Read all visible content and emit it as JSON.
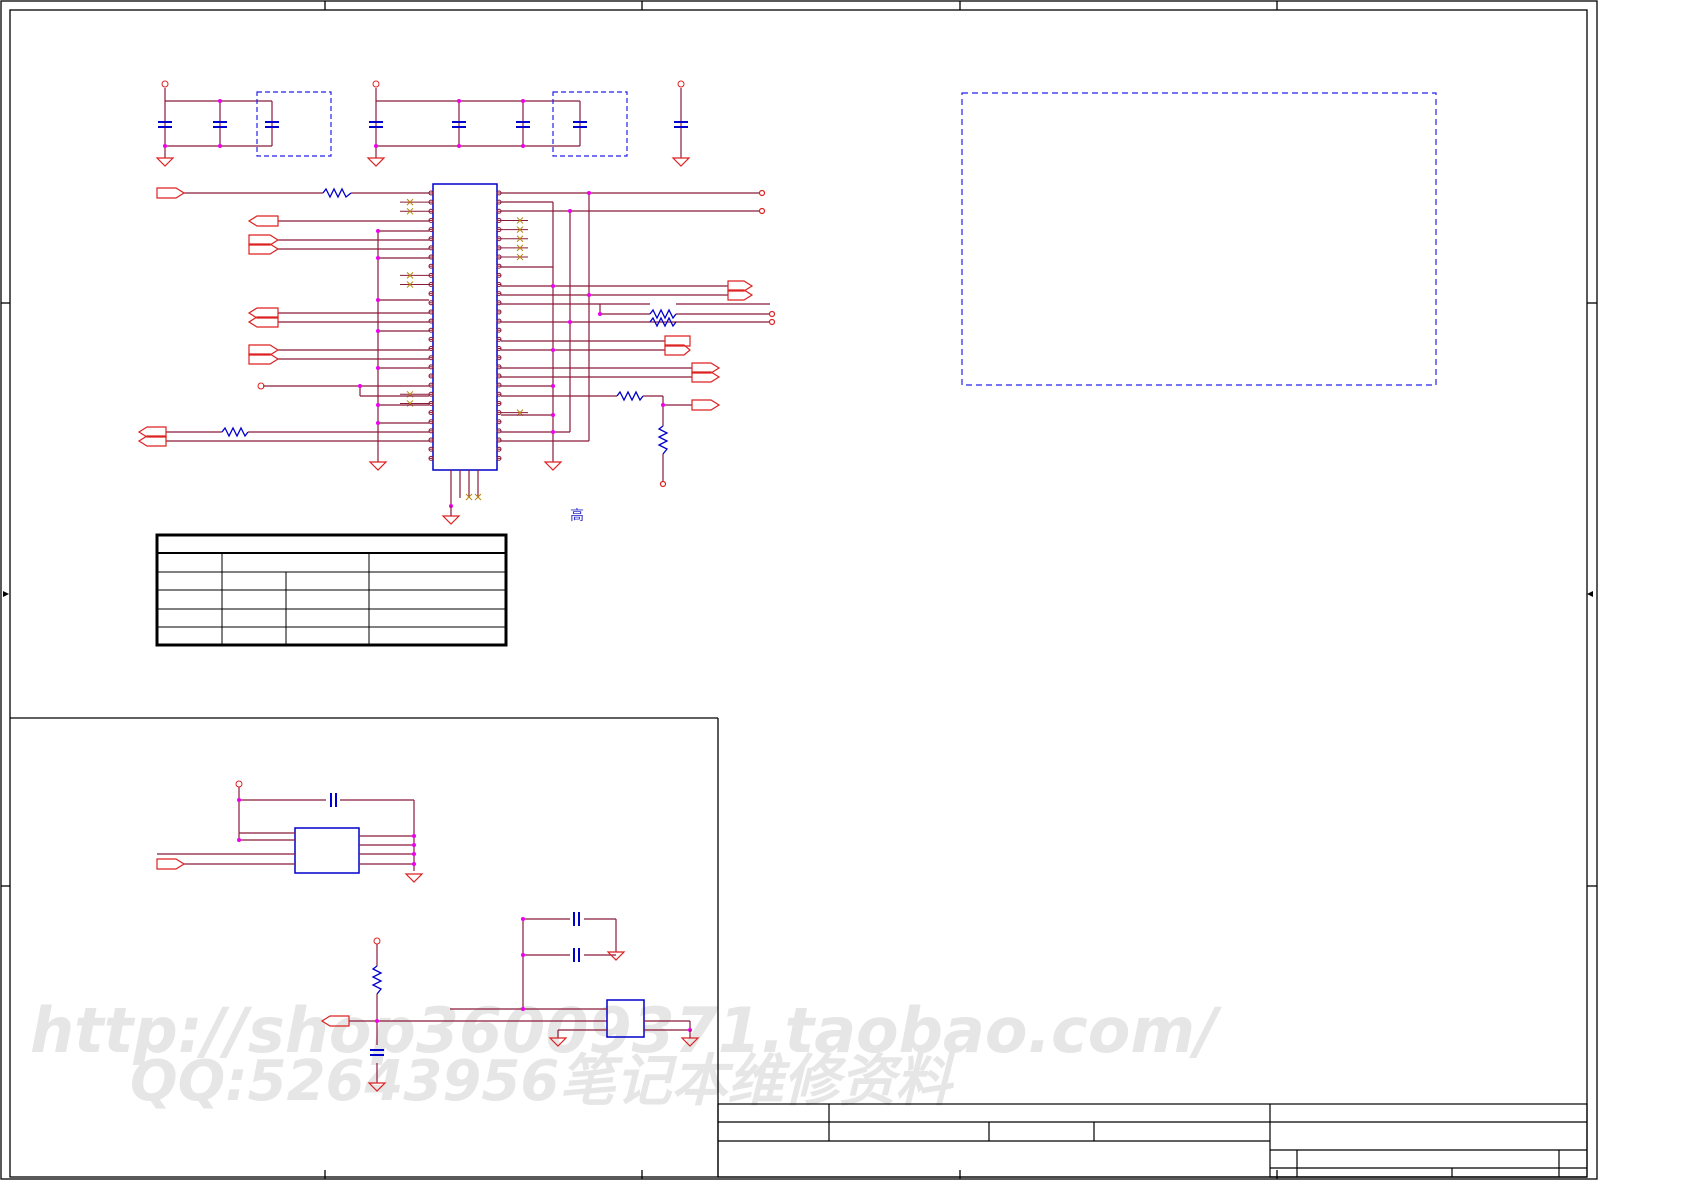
{
  "annotation": {
    "high_label": "高"
  },
  "watermark": {
    "line1": "http://shop36009371.taobao.com/",
    "line2": "QQ:52643956笔记本维修资料"
  },
  "colors": {
    "wire": "#8b1a3a",
    "component": "#0000cc",
    "power_net": "#dd2222",
    "junction": "#ee00ee",
    "border": "#000000",
    "dashed_box": "#2222ee",
    "no_connect": "#b8860b",
    "watermark": "#e4e4e4"
  }
}
